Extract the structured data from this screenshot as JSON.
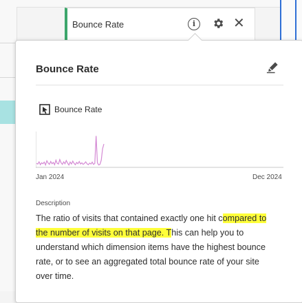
{
  "header_chip": {
    "label": "Bounce Rate",
    "icons": [
      "info-icon",
      "gear-icon",
      "close-icon"
    ]
  },
  "popover": {
    "title": "Bounce Rate",
    "metric_name": "Bounce Rate",
    "trend": {
      "start_label": "Jan 2024",
      "end_label": "Dec 2024",
      "line_color": "#d48ad4",
      "values": [
        0.1,
        0.08,
        0.15,
        0.06,
        0.12,
        0.09,
        0.14,
        0.05,
        0.18,
        0.11,
        0.07,
        0.16,
        0.09,
        0.13,
        0.06,
        0.2,
        0.1,
        0.08,
        0.22,
        0.12,
        0.07,
        0.15,
        0.09,
        0.19,
        0.11,
        0.05,
        0.14,
        0.08,
        0.17,
        0.1,
        0.06,
        0.13,
        0.09,
        0.16,
        0.08,
        0.12,
        0.07,
        0.1,
        0.15,
        0.09,
        0.06,
        0.11,
        0.08,
        0.14,
        0.07,
        0.1,
        0.95,
        0.12,
        0.05,
        0.07,
        0.2,
        0.55,
        0.7
      ]
    },
    "description_label": "Description",
    "description_parts": [
      "The ratio of visits that contained exactly one hit c",
      "ompared to the number of visits on that page. T",
      "his can help you to understand which dimension items have the highest bounce rate, or to see an aggregated total bounce rate of your site over time."
    ],
    "highlight_color": "#ffff3a"
  }
}
